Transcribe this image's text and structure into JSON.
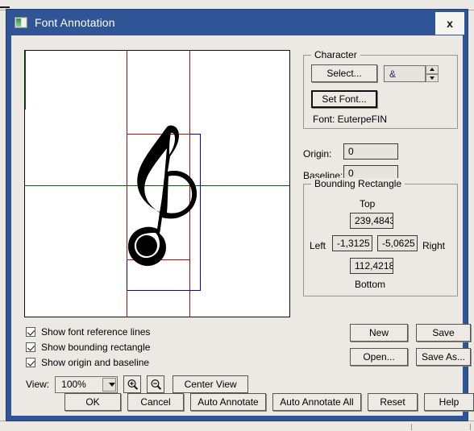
{
  "window": {
    "title": "Font Annotation",
    "icon": "image-window-icon",
    "close_label": "x",
    "titlebar_color": "#2F5596"
  },
  "canvas": {
    "reference_line_color": "#D00000",
    "bounding_rect_color": "#0000CC",
    "baseline_color": "#006400",
    "glyph": "treble-clef"
  },
  "options": {
    "items": [
      {
        "label": "Show font reference lines",
        "checked": true
      },
      {
        "label": "Show bounding rectangle",
        "checked": true
      },
      {
        "label": "Show origin and baseline",
        "checked": true
      }
    ]
  },
  "view": {
    "label": "View:",
    "zoom_value": "100%",
    "zoom_in_icon": "zoom-in-icon",
    "zoom_out_icon": "zoom-out-icon",
    "center_view_label": "Center View"
  },
  "character": {
    "legend": "Character",
    "select_label": "Select...",
    "set_font_label": "Set Font...",
    "char_value": "&",
    "font_label": "Font: EuterpeFIN"
  },
  "metrics": {
    "origin_label": "Origin:",
    "origin_value": "0",
    "baseline_label": "Baseline:",
    "baseline_value": "0"
  },
  "bounding": {
    "legend": "Bounding Rectangle",
    "top_label": "Top",
    "top_value": "239,4843",
    "left_label": "Left",
    "left_value": "-1,3125",
    "right_value": "-5,0625",
    "right_label": "Right",
    "bottom_value": "112,4218",
    "bottom_label": "Bottom"
  },
  "file_actions": {
    "new_label": "New",
    "save_label": "Save",
    "open_label": "Open...",
    "save_as_label": "Save As..."
  },
  "footer": {
    "ok_label": "OK",
    "cancel_label": "Cancel",
    "auto_annotate_label": "Auto Annotate",
    "auto_annotate_all_label": "Auto Annotate All",
    "reset_label": "Reset",
    "help_label": "Help"
  }
}
